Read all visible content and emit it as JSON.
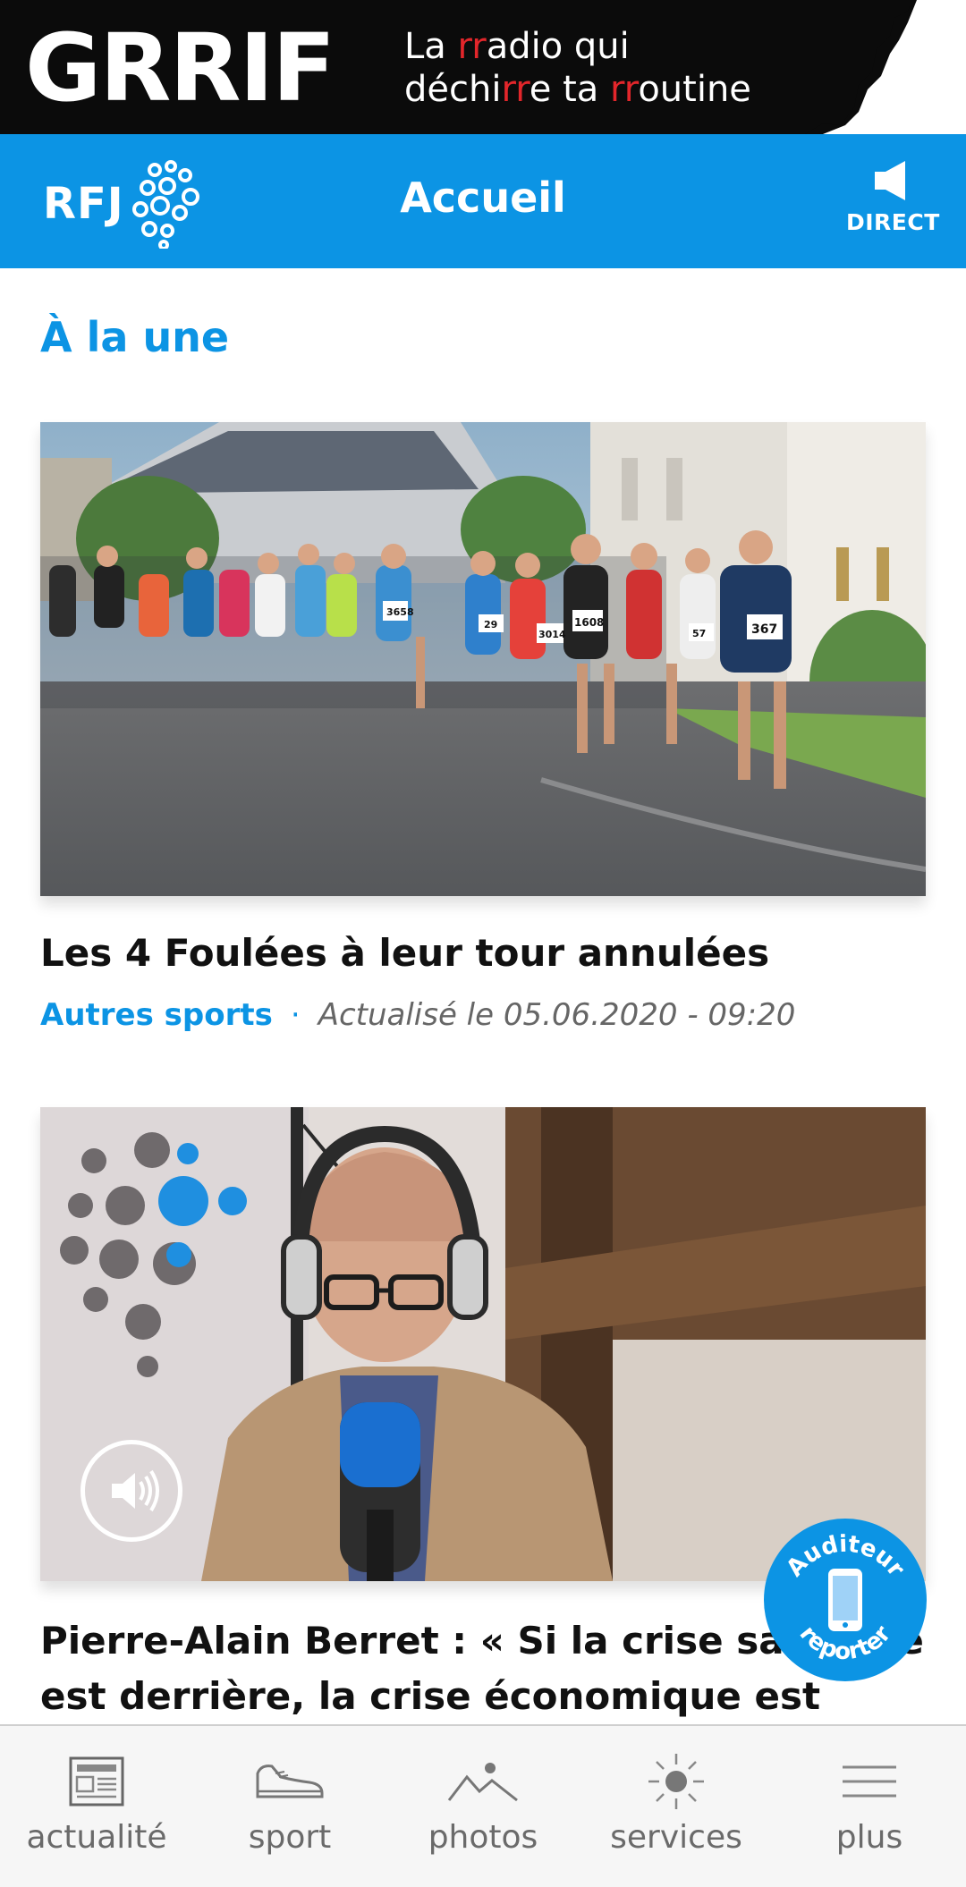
{
  "ad": {
    "logo": "GRRIF",
    "tagline_parts": [
      "La ",
      "rr",
      "adio qui",
      "déchi",
      "rr",
      "e ta ",
      "rr",
      "outine"
    ]
  },
  "header": {
    "logo_text": "RFJ",
    "title": "Accueil",
    "direct_label": "DIRECT"
  },
  "section": {
    "title": "À la une"
  },
  "articles": [
    {
      "title": "Les 4 Foulées à leur tour annulées",
      "category": "Autres sports",
      "separator": "·",
      "date": "Actualisé le 05.06.2020 - 09:20",
      "race_bibs": [
        "367",
        "1608",
        "3014",
        "29",
        "3658",
        "57"
      ]
    },
    {
      "title": "Pierre-Alain Berret : « Si la crise sanitaire est derrière, la crise économique est devant"
    }
  ],
  "reporter": {
    "line1": "Auditeur",
    "line2": "reporter"
  },
  "nav": {
    "items": [
      {
        "label": "actualité",
        "icon": "newspaper-icon"
      },
      {
        "label": "sport",
        "icon": "sneaker-icon"
      },
      {
        "label": "photos",
        "icon": "mountain-photo-icon"
      },
      {
        "label": "services",
        "icon": "sun-icon"
      },
      {
        "label": "plus",
        "icon": "menu-lines-icon"
      }
    ]
  },
  "colors": {
    "brand_blue": "#0c94e4",
    "ad_black": "#0b0b0b",
    "ad_red": "#e3262b"
  }
}
